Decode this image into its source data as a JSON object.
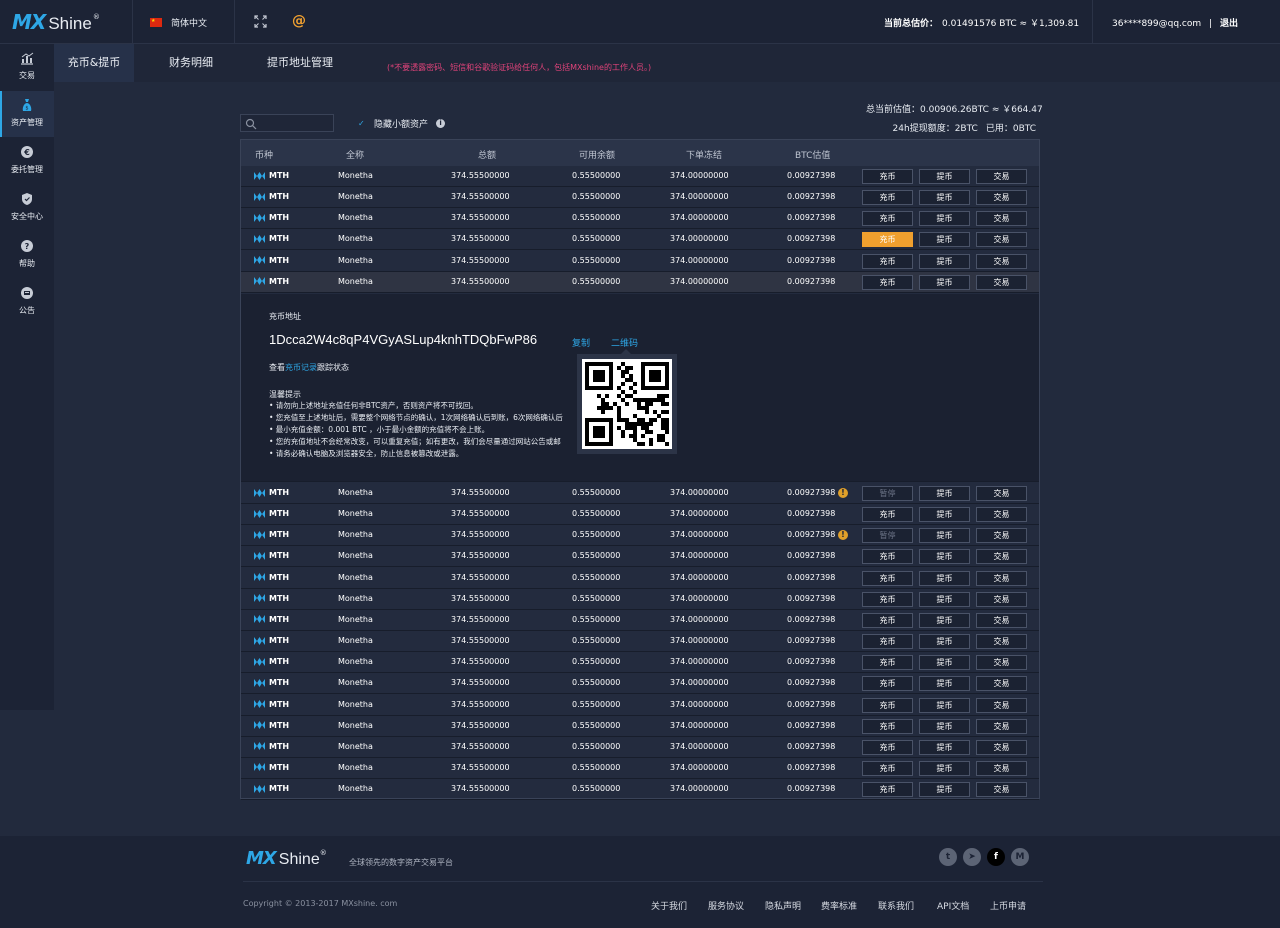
{
  "header": {
    "logo_mx": "MX",
    "logo_shine": "Shine",
    "logo_reg": "®",
    "language": "简体中文",
    "estimate_label": "当前总估价：",
    "estimate_value": "0.01491576 BTC ≈ ￥1,309.81",
    "user_email": "36****899@qq.com",
    "separator": "|",
    "logout": "退出",
    "at_symbol": "@"
  },
  "sidebar": {
    "items": [
      {
        "label": "交易",
        "icon": "chart-icon"
      },
      {
        "label": "资产管理",
        "icon": "money-bag-icon"
      },
      {
        "label": "委托管理",
        "icon": "euro-icon"
      },
      {
        "label": "安全中心",
        "icon": "shield-icon"
      },
      {
        "label": "帮助",
        "icon": "help-icon"
      },
      {
        "label": "公告",
        "icon": "announcement-icon"
      }
    ],
    "active_index": 1
  },
  "subnav": {
    "tabs": [
      "充币&提币",
      "财务明细",
      "提币地址管理"
    ],
    "active_index": 0,
    "warning": "(*不要透露密码、短信和谷歌验证码给任何人，包括MXshine的工作人员。)"
  },
  "filters": {
    "search_placeholder": "",
    "hide_small_label": "隐藏小额资产",
    "checkbox_mark": "✓",
    "info_mark": "i"
  },
  "summary": {
    "total_estimate": "总当前估值：0.00906.26BTC ≈ ￥664.47",
    "withdraw_limit": "24h提现额度：2BTC",
    "used": "已用：0BTC"
  },
  "table": {
    "headers": [
      "币种",
      "全称",
      "总额",
      "可用余额",
      "下单冻结",
      "BTC估值"
    ],
    "buttons": {
      "deposit": "充币",
      "withdraw": "提币",
      "trade": "交易",
      "paused": "暂停"
    },
    "rows_top": [
      {
        "coin": "MTH",
        "name": "Monetha",
        "total": "374.55500000",
        "available": "0.55500000",
        "frozen": "374.00000000",
        "btc": "0.00927398",
        "state": "normal"
      },
      {
        "coin": "MTH",
        "name": "Monetha",
        "total": "374.55500000",
        "available": "0.55500000",
        "frozen": "374.00000000",
        "btc": "0.00927398",
        "state": "normal"
      },
      {
        "coin": "MTH",
        "name": "Monetha",
        "total": "374.55500000",
        "available": "0.55500000",
        "frozen": "374.00000000",
        "btc": "0.00927398",
        "state": "normal"
      },
      {
        "coin": "MTH",
        "name": "Monetha",
        "total": "374.55500000",
        "available": "0.55500000",
        "frozen": "374.00000000",
        "btc": "0.00927398",
        "state": "hover"
      },
      {
        "coin": "MTH",
        "name": "Monetha",
        "total": "374.55500000",
        "available": "0.55500000",
        "frozen": "374.00000000",
        "btc": "0.00927398",
        "state": "normal"
      },
      {
        "coin": "MTH",
        "name": "Monetha",
        "total": "374.55500000",
        "available": "0.55500000",
        "frozen": "374.00000000",
        "btc": "0.00927398",
        "state": "selected"
      }
    ],
    "rows_bottom": [
      {
        "coin": "MTH",
        "name": "Monetha",
        "total": "374.55500000",
        "available": "0.55500000",
        "frozen": "374.00000000",
        "btc": "0.00927398",
        "state": "paused"
      },
      {
        "coin": "MTH",
        "name": "Monetha",
        "total": "374.55500000",
        "available": "0.55500000",
        "frozen": "374.00000000",
        "btc": "0.00927398",
        "state": "normal"
      },
      {
        "coin": "MTH",
        "name": "Monetha",
        "total": "374.55500000",
        "available": "0.55500000",
        "frozen": "374.00000000",
        "btc": "0.00927398",
        "state": "paused"
      },
      {
        "coin": "MTH",
        "name": "Monetha",
        "total": "374.55500000",
        "available": "0.55500000",
        "frozen": "374.00000000",
        "btc": "0.00927398",
        "state": "normal"
      },
      {
        "coin": "MTH",
        "name": "Monetha",
        "total": "374.55500000",
        "available": "0.55500000",
        "frozen": "374.00000000",
        "btc": "0.00927398",
        "state": "normal"
      },
      {
        "coin": "MTH",
        "name": "Monetha",
        "total": "374.55500000",
        "available": "0.55500000",
        "frozen": "374.00000000",
        "btc": "0.00927398",
        "state": "normal"
      },
      {
        "coin": "MTH",
        "name": "Monetha",
        "total": "374.55500000",
        "available": "0.55500000",
        "frozen": "374.00000000",
        "btc": "0.00927398",
        "state": "normal"
      },
      {
        "coin": "MTH",
        "name": "Monetha",
        "total": "374.55500000",
        "available": "0.55500000",
        "frozen": "374.00000000",
        "btc": "0.00927398",
        "state": "normal"
      },
      {
        "coin": "MTH",
        "name": "Monetha",
        "total": "374.55500000",
        "available": "0.55500000",
        "frozen": "374.00000000",
        "btc": "0.00927398",
        "state": "normal"
      },
      {
        "coin": "MTH",
        "name": "Monetha",
        "total": "374.55500000",
        "available": "0.55500000",
        "frozen": "374.00000000",
        "btc": "0.00927398",
        "state": "normal"
      },
      {
        "coin": "MTH",
        "name": "Monetha",
        "total": "374.55500000",
        "available": "0.55500000",
        "frozen": "374.00000000",
        "btc": "0.00927398",
        "state": "normal"
      },
      {
        "coin": "MTH",
        "name": "Monetha",
        "total": "374.55500000",
        "available": "0.55500000",
        "frozen": "374.00000000",
        "btc": "0.00927398",
        "state": "normal"
      },
      {
        "coin": "MTH",
        "name": "Monetha",
        "total": "374.55500000",
        "available": "0.55500000",
        "frozen": "374.00000000",
        "btc": "0.00927398",
        "state": "normal"
      },
      {
        "coin": "MTH",
        "name": "Monetha",
        "total": "374.55500000",
        "available": "0.55500000",
        "frozen": "374.00000000",
        "btc": "0.00927398",
        "state": "normal"
      },
      {
        "coin": "MTH",
        "name": "Monetha",
        "total": "374.55500000",
        "available": "0.55500000",
        "frozen": "374.00000000",
        "btc": "0.00927398",
        "state": "normal"
      }
    ]
  },
  "deposit": {
    "label": "充币地址",
    "address": "1Dcca2W4c8qP4VGyASLup4knhTDQbFwP86",
    "copy": "复制",
    "qr": "二维码",
    "record_prefix": "查看",
    "record_link": "充币记录",
    "record_suffix": "跟踪状态",
    "tips_title": "温馨提示",
    "tips": [
      "• 请勿向上述地址充值任何非BTC资产，否则资产将不可找回。",
      "• 您充值至上述地址后，需要整个网络节点的确认，1次网络确认后到账，6次网络确认后",
      "• 最小充值金额：0.001 BTC ，小于最小金额的充值将不会上账。",
      "• 您的充值地址不会经常改变，可以重复充值；如有更改，我们会尽量通过网站公告或邮",
      "• 请务必确认电脑及浏览器安全，防止信息被篡改或泄露。"
    ]
  },
  "footer": {
    "slogan": "全球领先的数字资产交易平台",
    "copyright": "Copyright © 2013-2017 MXshine. com",
    "links": [
      "关于我们",
      "服务协议",
      "隐私声明",
      "费率标准",
      "联系我们",
      "API文档",
      "上币申请"
    ],
    "social": [
      {
        "icon": "twitter-icon",
        "glyph": "t"
      },
      {
        "icon": "telegram-icon",
        "glyph": "➤"
      },
      {
        "icon": "facebook-icon",
        "glyph": "f"
      },
      {
        "icon": "monetha-icon",
        "glyph": "M"
      }
    ]
  },
  "colors": {
    "accent": "#2ea7e6",
    "hot_button": "#f0a02e",
    "warning_text": "#e0437a",
    "background": "#222a3d"
  }
}
